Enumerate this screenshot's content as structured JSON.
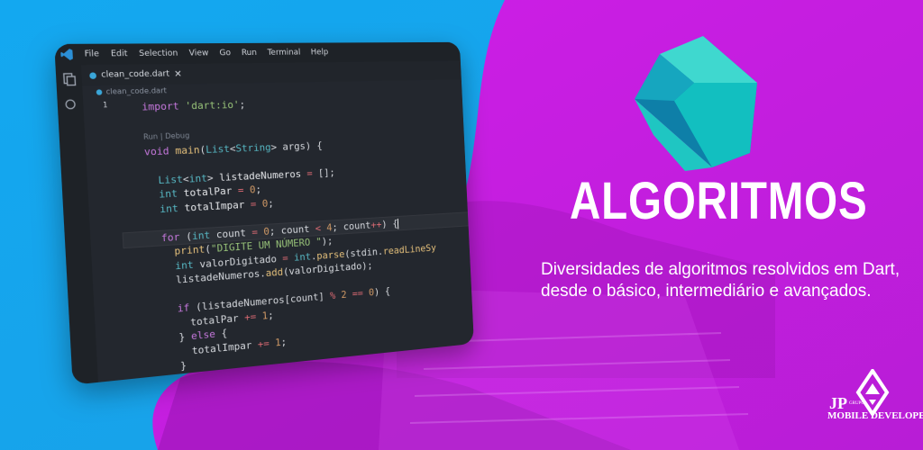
{
  "editor": {
    "menu": [
      "File",
      "Edit",
      "Selection",
      "View",
      "Go",
      "Run",
      "Terminal",
      "Help"
    ],
    "tab_name": "clean_code.dart",
    "breadcrumb": "clean_code.dart",
    "line_number": "1",
    "codelens": "Run | Debug",
    "code_lines": [
      "import 'dart:io';",
      "",
      "Run | Debug",
      "void main(List<String> args) {",
      "",
      "  List<int> listadeNumeros = [];",
      "  int totalPar = 0;",
      "  int totalImpar = 0;",
      "",
      "  for (int count = 0; count < 4; count++) {",
      "    print(\"DIGITE UM NÚMERO \");",
      "    int valorDigitado = int.parse(stdin.readLineSy",
      "    listadeNumeros.add(valorDigitado);",
      "",
      "    if (listadeNumeros[count] % 2 == 0) {",
      "      totalPar += 1;",
      "    } else {",
      "      totalImpar += 1;",
      "    }"
    ]
  },
  "headline": "ALGORITMOS",
  "description": "Diversidades de algoritmos resolvidos em Dart, desde o básico, intermediário e avançados.",
  "logo": {
    "initials": "JP",
    "small": "GRUPO",
    "name": "MOBILE DEVELOPER"
  },
  "colors": {
    "cyan": "#1aa7ec",
    "magenta": "#c41ee0",
    "editor_bg": "#23272e",
    "dart_teal": "#1fc6c2"
  }
}
